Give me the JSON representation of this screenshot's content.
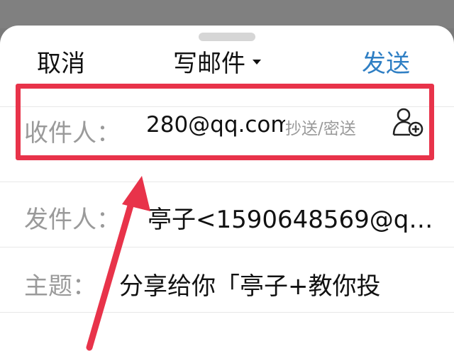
{
  "header": {
    "cancel_label": "取消",
    "title": "写邮件",
    "send_label": "发送"
  },
  "fields": {
    "to_label": "收件人：",
    "to_value": "280@qq.com",
    "cc_bcc_label": "抄送/密送",
    "from_label": "发件人：",
    "from_value": "亭子<1590648569@q…",
    "subject_label": "主题：",
    "subject_value": "分享给你「亭子+教你投"
  },
  "colors": {
    "accent": "#2f7fc4",
    "annotation": "#e8334a"
  },
  "icons": {
    "add_contact": "add-contact-icon",
    "title_dropdown": "caret-down-icon"
  }
}
